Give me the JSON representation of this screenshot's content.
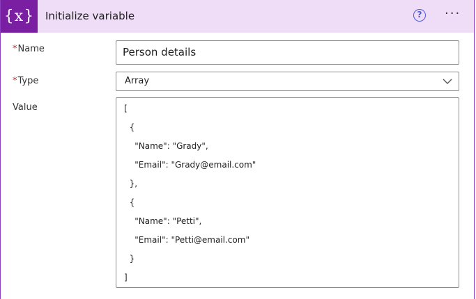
{
  "header": {
    "icon_text": "{x}",
    "title": "Initialize variable",
    "help_glyph": "?",
    "more_glyph": "···",
    "accent_color": "#7a1fa2",
    "header_bg": "#efdcf7"
  },
  "form": {
    "required_marker": "*",
    "name": {
      "label": "Name",
      "value": "Person details"
    },
    "type": {
      "label": "Type",
      "value": "Array"
    },
    "value": {
      "label": "Value",
      "lines": [
        "[",
        "  {",
        "    \"Name\": \"Grady\",",
        "    \"Email\": \"Grady@email.com\"",
        "  },",
        "  {",
        "    \"Name\": \"Petti\",",
        "    \"Email\": \"Petti@email.com\"",
        "  }",
        "]"
      ]
    }
  }
}
